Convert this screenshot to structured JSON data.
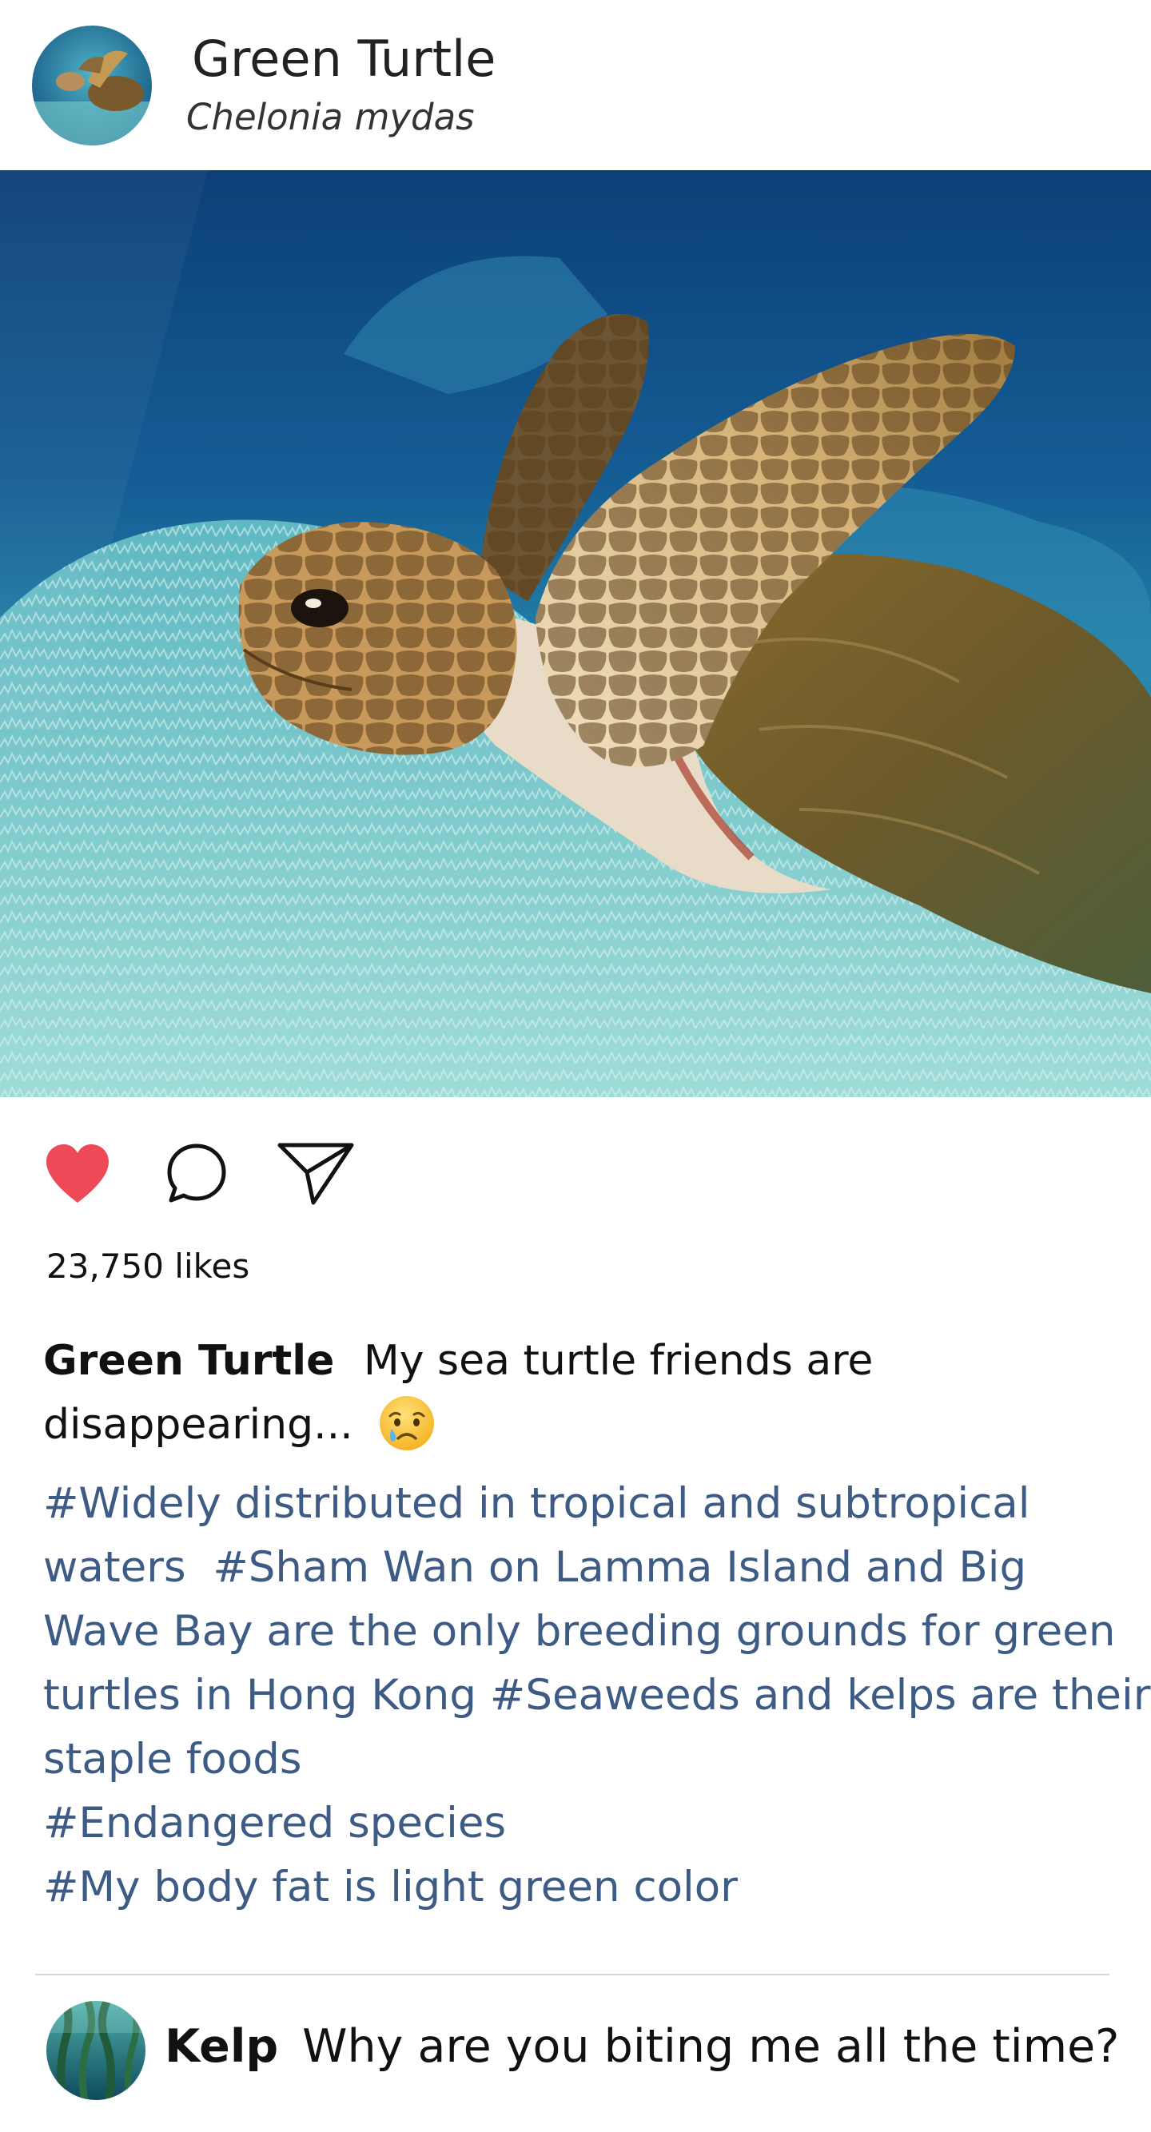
{
  "profile": {
    "name": "Green Turtle",
    "subtitle": "Chelonia mydas",
    "avatar_icon": "turtle-avatar"
  },
  "actions": {
    "like_icon": "heart-icon",
    "comment_icon": "comment-icon",
    "share_icon": "send-icon",
    "like_color": "#ed4956",
    "liked": true
  },
  "likes": {
    "text": "23,750 likes"
  },
  "caption": {
    "author": "Green Turtle",
    "text": "My sea turtle friends are disappearing...",
    "emoji": "crying-face-icon"
  },
  "hashtags": [
    "#Widely distributed in tropical and subtropical waters",
    "#Sham Wan on Lamma Island and Big Wave Bay are the only breeding grounds for green turtles in Hong Kong",
    "#Seaweeds and kelps are their staple foods",
    "#Endangered species",
    "#My body fat is light green color"
  ],
  "comments": [
    {
      "author": "Kelp",
      "text": "Why are you biting me all the time?",
      "avatar_icon": "kelp-avatar"
    }
  ],
  "colors": {
    "hashtag": "#3d5b84",
    "heart": "#ed4956",
    "text": "#111111",
    "divider": "#d6d6d6"
  }
}
